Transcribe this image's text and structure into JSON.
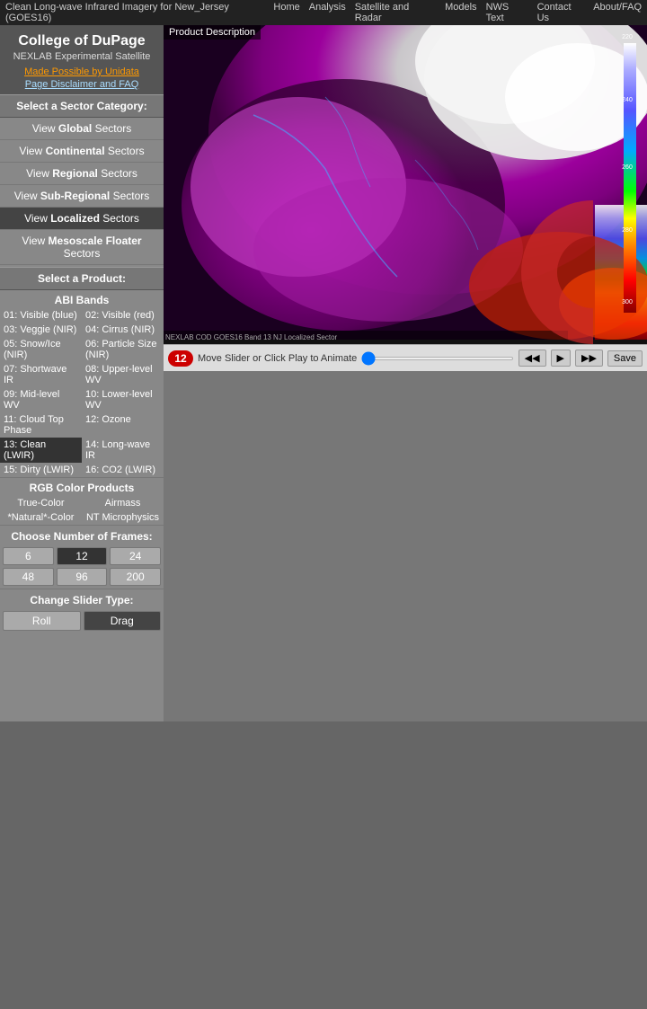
{
  "titlebar": {
    "title": "Clean Long-wave Infrared Imagery for New_Jersey (GOES16)",
    "nav": [
      "Home",
      "Analysis",
      "Satellite and Radar",
      "Models",
      "NWS Text",
      "Contact Us",
      "About/FAQ"
    ]
  },
  "sidebar": {
    "college_name": "College of DuPage",
    "nexlab_label": "NEXLAB Experimental Satellite",
    "unidata_link": "Made Possible by Unidata",
    "disclaimer_link": "Page Disclaimer and FAQ",
    "sector_category_label": "Select a Sector Category:",
    "sector_buttons": [
      {
        "id": "global",
        "text": "View ",
        "bold": "Global",
        "text2": " Sectors",
        "active": false
      },
      {
        "id": "continental",
        "text": "View ",
        "bold": "Continental",
        "text2": " Sectors",
        "active": false
      },
      {
        "id": "regional",
        "text": "View ",
        "bold": "Regional",
        "text2": " Sectors",
        "active": false
      },
      {
        "id": "subregional",
        "text": "View ",
        "bold": "Sub-Regional",
        "text2": " Sectors",
        "active": false
      },
      {
        "id": "localized",
        "text": "View ",
        "bold": "Localized",
        "text2": " Sectors",
        "active": true
      },
      {
        "id": "mesoscale",
        "text": "View ",
        "bold": "Mesoscale Floater",
        "text2": " Sectors",
        "active": false
      }
    ],
    "product_label": "Select a Product:",
    "abi_bands_label": "ABI Bands",
    "bands": [
      {
        "id": "b01",
        "label": "01: Visible (blue)",
        "active": false
      },
      {
        "id": "b02",
        "label": "02: Visible (red)",
        "active": false
      },
      {
        "id": "b03",
        "label": "03: Veggie (NIR)",
        "active": false
      },
      {
        "id": "b04",
        "label": "04: Cirrus (NIR)",
        "active": false
      },
      {
        "id": "b05",
        "label": "05: Snow/Ice (NIR)",
        "active": false
      },
      {
        "id": "b06",
        "label": "06: Particle Size (NIR)",
        "active": false
      },
      {
        "id": "b07",
        "label": "07: Shortwave IR",
        "active": false
      },
      {
        "id": "b08",
        "label": "08: Upper-level WV",
        "active": false
      },
      {
        "id": "b09",
        "label": "09: Mid-level WV",
        "active": false
      },
      {
        "id": "b10",
        "label": "10: Lower-level WV",
        "active": false
      },
      {
        "id": "b11",
        "label": "11: Cloud Top Phase",
        "active": false
      },
      {
        "id": "b12",
        "label": "12: Ozone",
        "active": false
      },
      {
        "id": "b13",
        "label": "13: Clean (LWIR)",
        "active": true
      },
      {
        "id": "b14",
        "label": "14: Long-wave IR",
        "active": false
      },
      {
        "id": "b15",
        "label": "15: Dirty (LWIR)",
        "active": false
      },
      {
        "id": "b16",
        "label": "16: CO2 (LWIR)",
        "active": false
      }
    ],
    "rgb_label": "RGB Color Products",
    "rgb_products": [
      {
        "id": "true-color",
        "label": "True-Color"
      },
      {
        "id": "airmass",
        "label": "Airmass"
      },
      {
        "id": "natural-color",
        "label": "*Natural*-Color"
      },
      {
        "id": "nt-microphysics",
        "label": "NT Microphysics"
      }
    ],
    "frames_label": "Choose Number of Frames:",
    "frames": [
      {
        "val": "6",
        "active": false
      },
      {
        "val": "12",
        "active": true
      },
      {
        "val": "24",
        "active": false
      },
      {
        "val": "48",
        "active": false
      },
      {
        "val": "96",
        "active": false
      },
      {
        "val": "200",
        "active": false
      }
    ],
    "slider_type_label": "Change Slider Type:",
    "slider_options": [
      {
        "val": "Roll",
        "active": false
      },
      {
        "val": "Drag",
        "active": true
      }
    ]
  },
  "content": {
    "product_description": "Product Description",
    "anim_label": "Move Slider or Click Play to Animate",
    "frame_counter": "12",
    "save_btn_label": "Save",
    "anim_controls": {
      "rewind_label": "◀◀",
      "play_label": "▶",
      "ff_label": "▶▶"
    }
  }
}
